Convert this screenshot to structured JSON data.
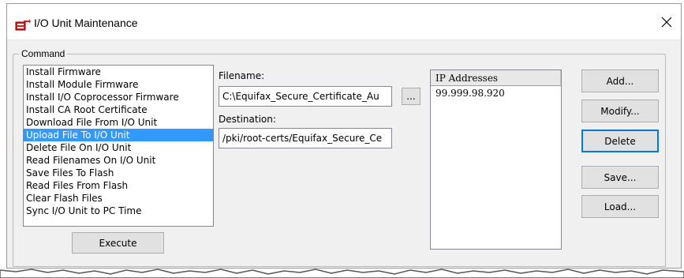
{
  "window": {
    "title": "I/O Unit Maintenance",
    "close_glyph": "×",
    "icons": {
      "app": "io-unit-icon",
      "close": "close-icon"
    }
  },
  "command": {
    "group_label": "Command",
    "items": [
      {
        "label": "Install Firmware",
        "selected": false
      },
      {
        "label": "Install Module Firmware",
        "selected": false
      },
      {
        "label": "Install I/O Coprocessor Firmware",
        "selected": false
      },
      {
        "label": "Install CA Root Certificate",
        "selected": false
      },
      {
        "label": "Download File From I/O Unit",
        "selected": false
      },
      {
        "label": "Upload File To I/O Unit",
        "selected": true
      },
      {
        "label": "Delete File On I/O Unit",
        "selected": false
      },
      {
        "label": "Read Filenames On I/O Unit",
        "selected": false
      },
      {
        "label": "Save Files To Flash",
        "selected": false
      },
      {
        "label": "Read Files From Flash",
        "selected": false
      },
      {
        "label": "Clear Flash Files",
        "selected": false
      },
      {
        "label": "Sync I/O Unit to PC Time",
        "selected": false
      }
    ],
    "execute_label": "Execute"
  },
  "file": {
    "filename_label": "Filename:",
    "filename_value": "C:\\Equifax_Secure_Certificate_Au",
    "browse_label": "...",
    "destination_label": "Destination:",
    "destination_value": "/pki/root-certs/Equifax_Secure_Ce"
  },
  "ip": {
    "header": "IP Addresses",
    "rows": [
      "99.999.98.920"
    ]
  },
  "actions": {
    "add_label": "Add...",
    "modify_label": "Modify...",
    "delete_label": "Delete",
    "save_label": "Save...",
    "load_label": "Load..."
  },
  "colors": {
    "selection": "#3399ff",
    "dialog_bg": "#f0f0f0",
    "button_bg": "#e1e1e1",
    "focus_border": "#0078d7"
  }
}
